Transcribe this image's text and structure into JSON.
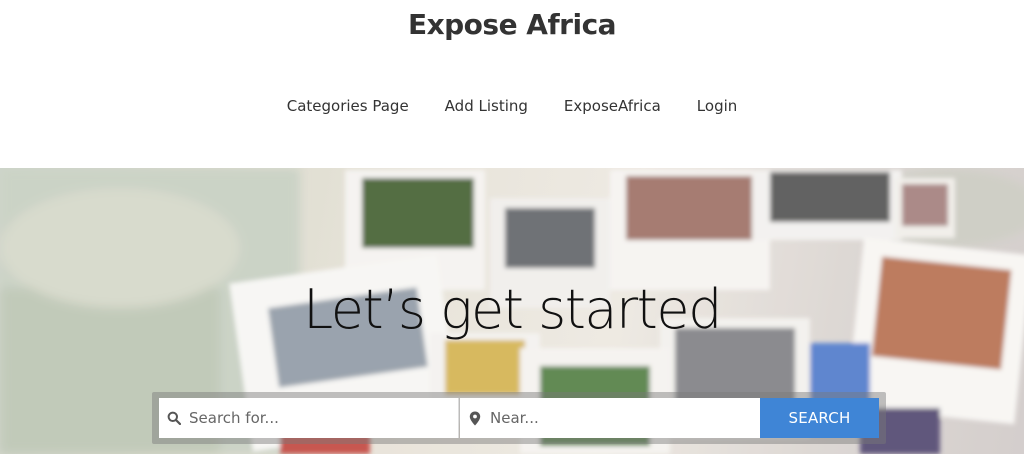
{
  "site": {
    "title": "Expose Africa"
  },
  "nav": {
    "items": [
      {
        "label": "Categories Page"
      },
      {
        "label": "Add Listing"
      },
      {
        "label": "ExposeAfrica"
      },
      {
        "label": "Login"
      }
    ]
  },
  "hero": {
    "title": "Let’s get started"
  },
  "search": {
    "for_placeholder": "Search for...",
    "near_placeholder": "Near...",
    "button_label": "SEARCH",
    "search_icon": "search-icon",
    "location_icon": "map-pin-icon"
  },
  "colors": {
    "accent": "#3f85d6",
    "text": "#333333"
  }
}
